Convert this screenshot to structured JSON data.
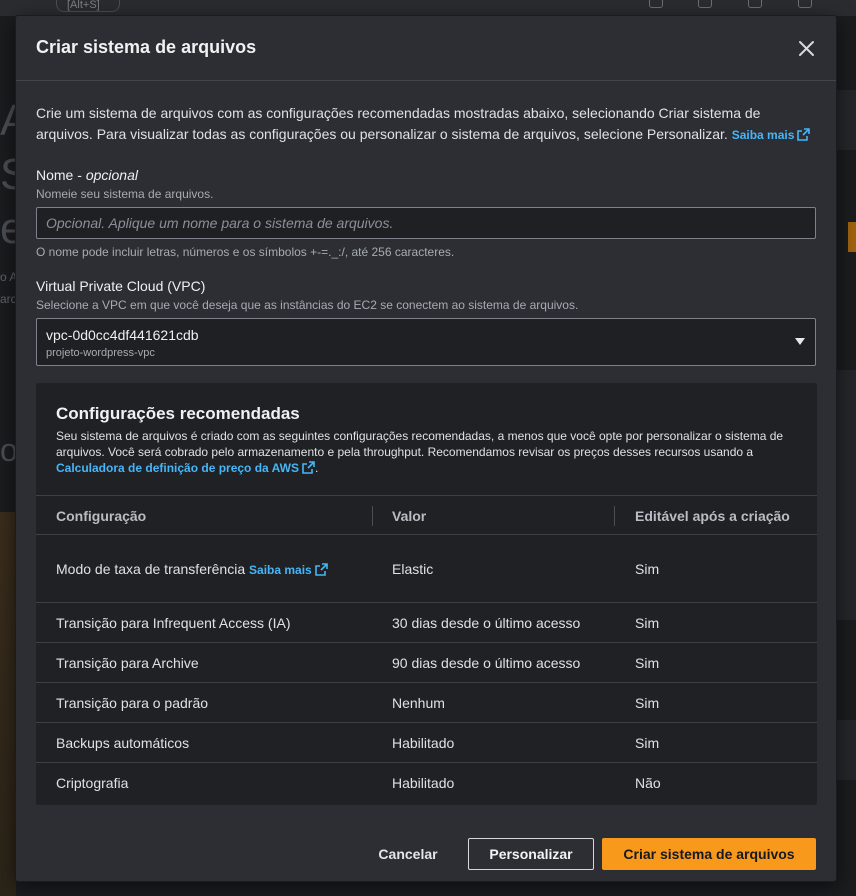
{
  "background": {
    "shortcut_hint": "[Alt+S]",
    "letters": [
      "A",
      "S",
      "e"
    ],
    "snippets": [
      "o A",
      "arq",
      "o"
    ]
  },
  "modal": {
    "title": "Criar sistema de arquivos",
    "intro_text": "Crie um sistema de arquivos com as configurações recomendadas mostradas abaixo, selecionando Criar sistema de arquivos. Para visualizar todas as configurações ou personalizar o sistema de arquivos, selecione Personalizar.",
    "intro_link": "Saiba mais",
    "name_field": {
      "label": "Nome",
      "label_optional": "opcional",
      "description": "Nomeie seu sistema de arquivos.",
      "placeholder": "Opcional. Aplique um nome para o sistema de arquivos.",
      "value": "",
      "constraint": "O nome pode incluir letras, números e os símbolos +-=._:/, até 256 caracteres."
    },
    "vpc_field": {
      "label": "Virtual Private Cloud (VPC)",
      "description": "Selecione a VPC em que você deseja que as instâncias do EC2 se conectem ao sistema de arquivos.",
      "selected_value": "vpc-0d0cc4df441621cdb",
      "selected_sublabel": "projeto-wordpress-vpc"
    },
    "recommended": {
      "title": "Configurações recomendadas",
      "description": "Seu sistema de arquivos é criado com as seguintes configurações recomendadas, a menos que você opte por personalizar o sistema de arquivos. Você será cobrado pelo armazenamento e pela throughput. Recomendamos revisar os preços desses recursos usando a",
      "pricing_link": "Calculadora de definição de preço da AWS",
      "columns": [
        "Configuração",
        "Valor",
        "Editável após a criação"
      ],
      "rows": [
        {
          "config": "Modo de taxa de transferência",
          "link": "Saiba mais",
          "value": "Elastic",
          "editable": "Sim"
        },
        {
          "config": "Transição para Infrequent Access (IA)",
          "value": "30 dias desde o último acesso",
          "editable": "Sim"
        },
        {
          "config": "Transição para Archive",
          "value": "90 dias desde o último acesso",
          "editable": "Sim"
        },
        {
          "config": "Transição para o padrão",
          "value": "Nenhum",
          "editable": "Sim"
        },
        {
          "config": "Backups automáticos",
          "value": "Habilitado",
          "editable": "Sim"
        },
        {
          "config": "Criptografia",
          "value": "Habilitado",
          "editable": "Não"
        }
      ]
    },
    "footer": {
      "cancel_label": "Cancelar",
      "customize_label": "Personalizar",
      "create_label": "Criar sistema de arquivos"
    }
  },
  "colors": {
    "accent_link": "#45b6f7",
    "primary_button": "#f8991c",
    "modal_bg": "#2c2e33"
  }
}
